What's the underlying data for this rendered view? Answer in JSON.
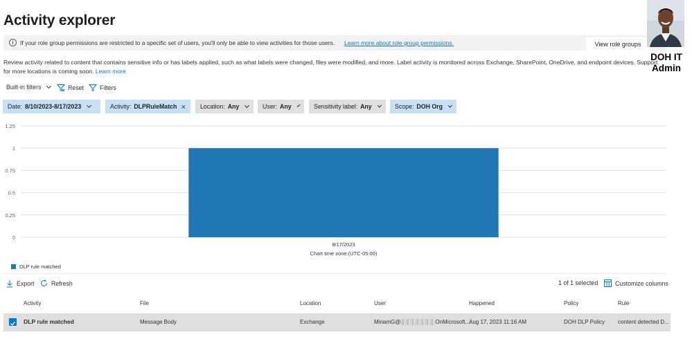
{
  "page": {
    "title": "Activity explorer"
  },
  "info_bar": {
    "text": "If your role group permissions are restricted to a specific set of users, you'll only be able to view activities for those users.",
    "link": "Learn more about role group permissions.",
    "button": "View role groups"
  },
  "user": {
    "name_line1": "DOH IT",
    "name_line2": "Admin"
  },
  "description": {
    "text": "Review activity related to content that contains sensitive info or has labels applied, such as what labels were changed, files were modified, and more. Label activity is monitored across Exchange, SharePoint, OneDrive, and endpoint devices. Support for more locations is coming soon.",
    "link": "Learn more"
  },
  "toolbar": {
    "builtin_filters": "Built-in filters",
    "reset": "Reset",
    "filters": "Filters"
  },
  "filters": [
    {
      "label": "Date:",
      "value": "8/10/2023-8/17/2023",
      "active": true
    },
    {
      "label": "Activity:",
      "value": "DLPRuleMatch",
      "active": true
    },
    {
      "label": "Location:",
      "value": "Any",
      "active": false
    },
    {
      "label": "User:",
      "value": "Any",
      "active": false
    },
    {
      "label": "Sensitivity label:",
      "value": "Any",
      "active": false
    },
    {
      "label": "Scope:",
      "value": "DOH Org",
      "active": true
    }
  ],
  "chart_data": {
    "type": "bar",
    "categories": [
      "8/17/2023"
    ],
    "series": [
      {
        "name": "DLP rule matched",
        "values": [
          1
        ],
        "color": "#1f77b4"
      }
    ],
    "yticks": [
      "1.25",
      "1",
      "0.75",
      "0.5",
      "0.25",
      "0"
    ],
    "ylim": [
      0,
      1.25
    ],
    "xlabel": "Chart time zone:(UTC-05:00)",
    "ylabel": "",
    "grid": true,
    "legend_position": "bottom-left"
  },
  "table_toolbar": {
    "export": "Export",
    "refresh": "Refresh",
    "selected": "1 of 1 selected",
    "customize": "Customize columns"
  },
  "table": {
    "columns": [
      "Activity",
      "File",
      "Location",
      "User",
      "Happened",
      "Policy",
      "Rule"
    ],
    "rows": [
      {
        "activity": "DLP rule matched",
        "file": "Message Body",
        "location": "Exchange",
        "user_prefix": "MiriamG@",
        "user_suffix": "OnMicrosoft....",
        "happened": "Aug 17, 2023 11:16 AM",
        "policy": "DOH DLP Policy",
        "rule": "content detected D...",
        "selected": true
      }
    ]
  }
}
